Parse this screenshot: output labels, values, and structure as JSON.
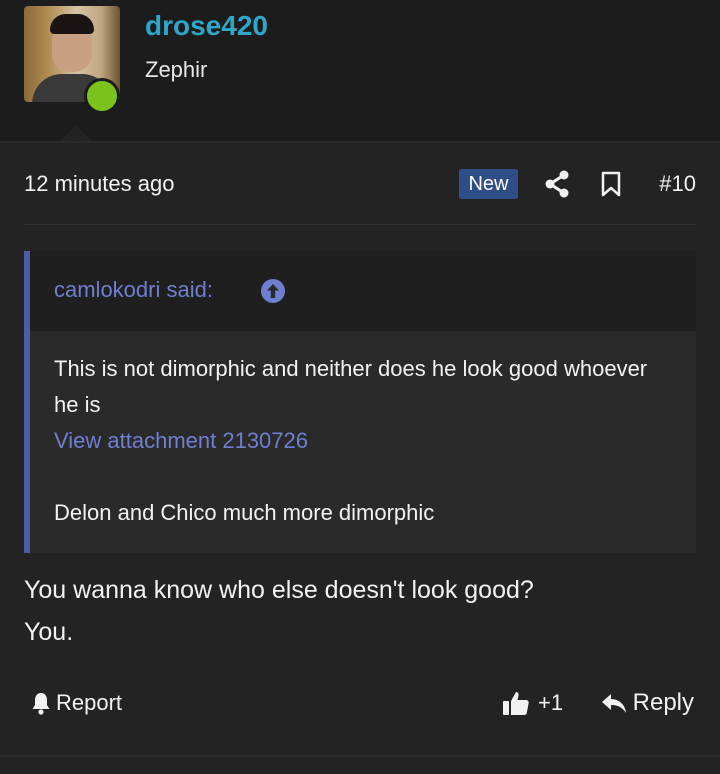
{
  "user": {
    "username": "drose420",
    "title": "Zephir",
    "online": true
  },
  "post": {
    "timestamp": "12 minutes ago",
    "new_badge": "New",
    "number": "#10",
    "quote": {
      "author": "camlokodri said:",
      "line1": "This is not dimorphic and neither does he look good whoever he is",
      "attachment_link": "View attachment 2130726",
      "line2": "Delon and Chico much more dimorphic"
    },
    "text_line1": "You wanna know who else doesn't look good?",
    "text_line2": "You.",
    "actions": {
      "report_label": "Report",
      "like_count": "+1",
      "reply_label": "Reply"
    }
  },
  "colors": {
    "username": "#2fa7c9",
    "quote_accent": "#4d5ca8",
    "link": "#6f7fd0",
    "new_badge_bg": "#2f4d86",
    "online": "#7cc21d"
  },
  "icons": {
    "share": "share-icon",
    "bookmark": "bookmark-icon",
    "quote_jump": "arrow-up-circle-icon",
    "report": "bell-icon",
    "like": "thumbs-up-icon",
    "reply": "reply-arrow-icon"
  }
}
